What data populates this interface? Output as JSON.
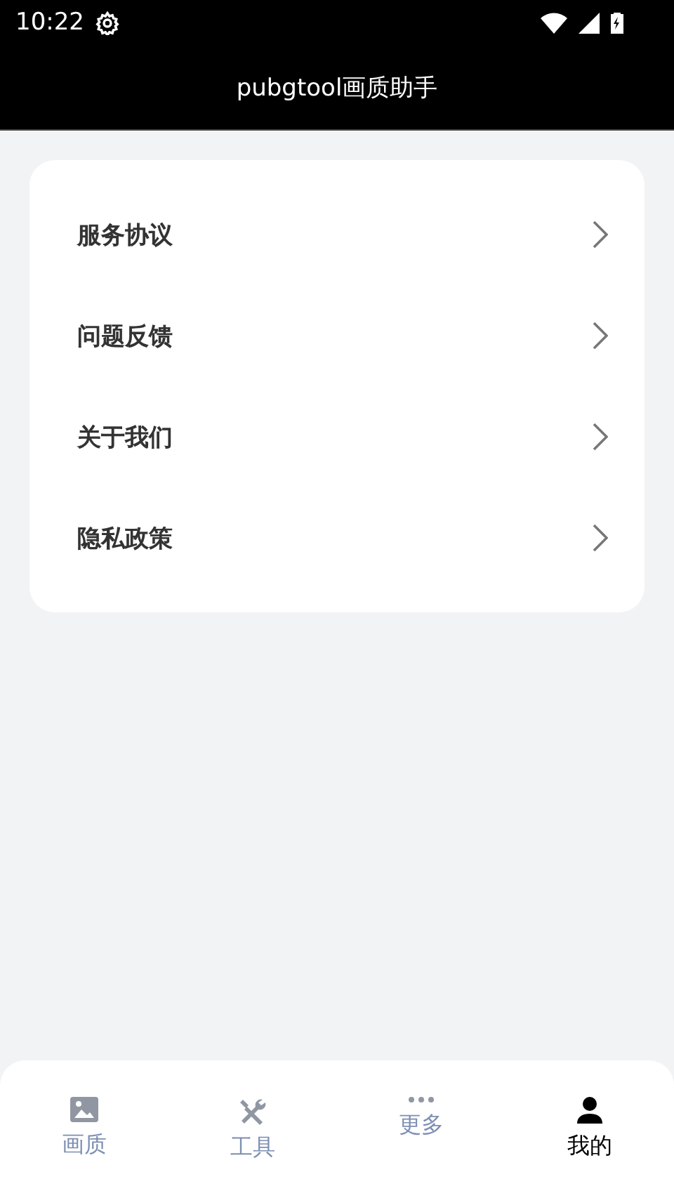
{
  "status_bar": {
    "time": "10:22"
  },
  "app_bar": {
    "title": "pubgtool画质助手"
  },
  "menu": [
    {
      "label": "服务协议"
    },
    {
      "label": "问题反馈"
    },
    {
      "label": "关于我们"
    },
    {
      "label": "隐私政策"
    }
  ],
  "tab_bar": [
    {
      "label": "画质",
      "kind": "image",
      "selected": false
    },
    {
      "label": "工具",
      "kind": "tools",
      "selected": false
    },
    {
      "label": "更多",
      "kind": "more",
      "selected": false
    },
    {
      "label": "我的",
      "kind": "person",
      "selected": true
    }
  ]
}
